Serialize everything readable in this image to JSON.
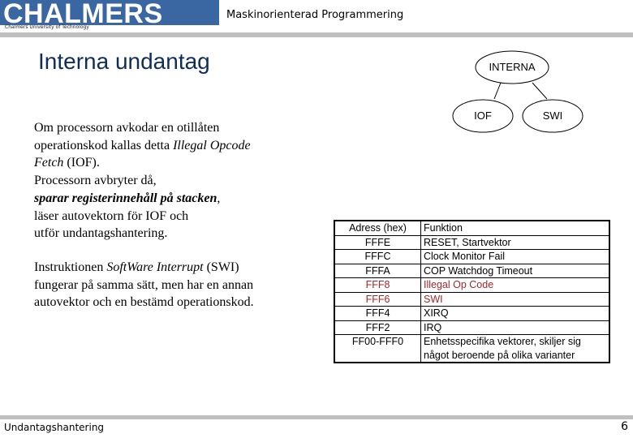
{
  "header": {
    "logo_text": "CHALMERS",
    "logo_subtitle": "Chalmers University of Technology",
    "course_title": "Maskinorienterad Programmering",
    "brand_color": "#3a67a2"
  },
  "slide": {
    "title": "Interna undantag",
    "paragraph1": {
      "line1": "Om processorn avkodar en otillåten",
      "line2_pre": "operationskod kallas detta ",
      "line2_italic": "Illegal Opcode",
      "line3_italic": "Fetch",
      "line3_post": " (IOF).",
      "line4": "Processorn avbryter då,",
      "line5_bolditalic": "sparar registerinnehåll på stacken",
      "line5_post": ",",
      "line6": "läser autovektorn för IOF och",
      "line7": "utför undantagshantering."
    },
    "paragraph2": {
      "line1_pre": "Instruktionen ",
      "line1_italic": "SoftWare Interrupt",
      "line1_post": " (SWI)",
      "line2": "fungerar på samma sätt, men har en annan",
      "line3": "autovektor och en bestämd operationskod."
    }
  },
  "tree": {
    "root": "INTERNA",
    "children": [
      "IOF",
      "SWI"
    ]
  },
  "vector_table": {
    "headers": [
      "Adress (hex)",
      "Funktion"
    ],
    "highlight_color": "#a3262a",
    "rows": [
      {
        "address": "FFFE",
        "function": "RESET, Startvektor",
        "highlight": false
      },
      {
        "address": "FFFC",
        "function": "Clock Monitor Fail",
        "highlight": false
      },
      {
        "address": "FFFA",
        "function": "COP Watchdog Timeout",
        "highlight": false
      },
      {
        "address": "FFF8",
        "function": "Illegal Op Code",
        "highlight": true
      },
      {
        "address": "FFF6",
        "function": "SWI",
        "highlight": true
      },
      {
        "address": "FFF4",
        "function": "XIRQ",
        "highlight": false
      },
      {
        "address": "FFF2",
        "function": "IRQ",
        "highlight": false
      },
      {
        "address": "FF00-FFF0",
        "function_line1": "Enhetsspecifika vektorer, skiljer sig",
        "function_line2": "något beroende på olika varianter",
        "highlight": false
      }
    ]
  },
  "footer": {
    "section": "Undantagshantering",
    "page_number": "6"
  }
}
